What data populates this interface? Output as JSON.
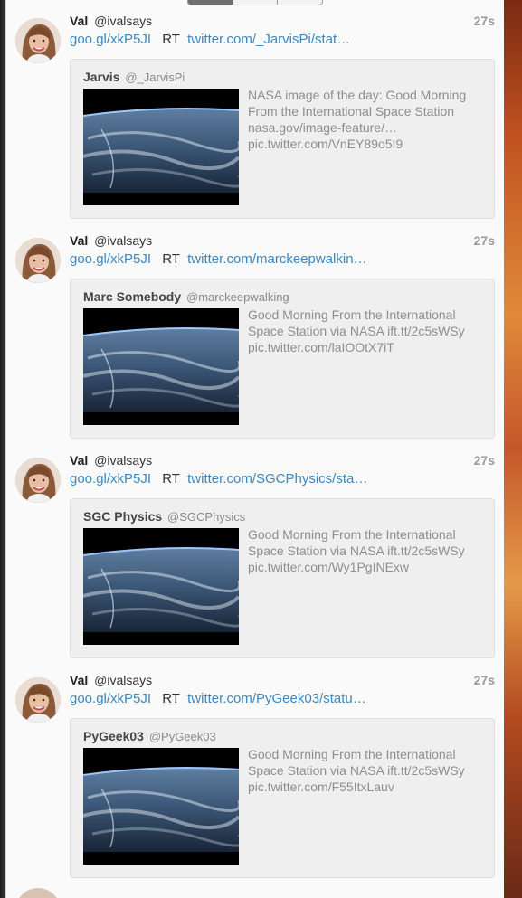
{
  "timeline": {
    "tweets": [
      {
        "author_name": "Val",
        "author_handle": "@ivalsays",
        "time": "27s",
        "short_link": "goo.gl/xkP5JI",
        "rt_label": "RT",
        "status_link": "twitter.com/_JarvisPi/stat…",
        "quote": {
          "name": "Jarvis",
          "handle": "@_JarvisPi",
          "lines": [
            "NASA image of the day: Good Morning",
            "From the International Space Station",
            "nasa.gov/image-feature/…",
            "pic.twitter.com/VnEY89o5I9"
          ]
        }
      },
      {
        "author_name": "Val",
        "author_handle": "@ivalsays",
        "time": "27s",
        "short_link": "goo.gl/xkP5JI",
        "rt_label": "RT",
        "status_link": "twitter.com/marckeepwalkin…",
        "quote": {
          "name": "Marc Somebody",
          "handle": "@marckeepwalking",
          "lines": [
            "Good Morning From the International",
            "Space Station via NASA ift.tt/2c5sWSy",
            "pic.twitter.com/laIOOtX7iT"
          ]
        }
      },
      {
        "author_name": "Val",
        "author_handle": "@ivalsays",
        "time": "27s",
        "short_link": "goo.gl/xkP5JI",
        "rt_label": "RT",
        "status_link": "twitter.com/SGCPhysics/sta…",
        "quote": {
          "name": "SGC Physics",
          "handle": "@SGCPhysics",
          "lines": [
            "Good Morning From the International",
            "Space Station via NASA ift.tt/2c5sWSy",
            "pic.twitter.com/Wy1PgINExw"
          ]
        }
      },
      {
        "author_name": "Val",
        "author_handle": "@ivalsays",
        "time": "27s",
        "short_link": "goo.gl/xkP5JI",
        "rt_label": "RT",
        "status_link": "twitter.com/PyGeek03/statu…",
        "quote": {
          "name": "PyGeek03",
          "handle": "@PyGeek03",
          "lines": [
            "Good Morning From the International",
            "Space Station via NASA ift.tt/2c5sWSy",
            "pic.twitter.com/F55ItxLauv"
          ]
        }
      }
    ]
  },
  "colors": {
    "link": "#3b88c3",
    "quote_bg": "#efefef",
    "muted_text": "#8e8e8e",
    "timestamp": "#9a9a9a"
  },
  "icons": {
    "avatar": "avatar-photo",
    "media": "earth-from-space-photo"
  }
}
